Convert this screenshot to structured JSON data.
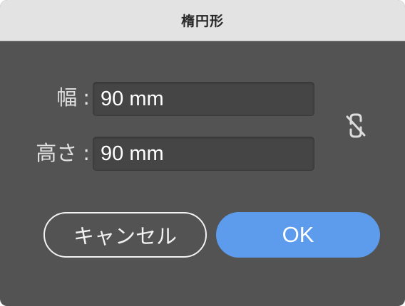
{
  "dialog": {
    "title": "楕円形"
  },
  "fields": {
    "width": {
      "label": "幅",
      "separator": ":",
      "value": "90 mm"
    },
    "height": {
      "label": "高さ",
      "separator": ":",
      "value": "90 mm"
    }
  },
  "constrain_link": {
    "icon": "unlinked-chain-icon",
    "state": "unlinked"
  },
  "buttons": {
    "cancel_label": "キャンセル",
    "ok_label": "OK"
  },
  "colors": {
    "dialog_background": "#535353",
    "titlebar_background": "#e3e3e3",
    "input_background": "#454545",
    "primary_button": "#5d9ced"
  }
}
